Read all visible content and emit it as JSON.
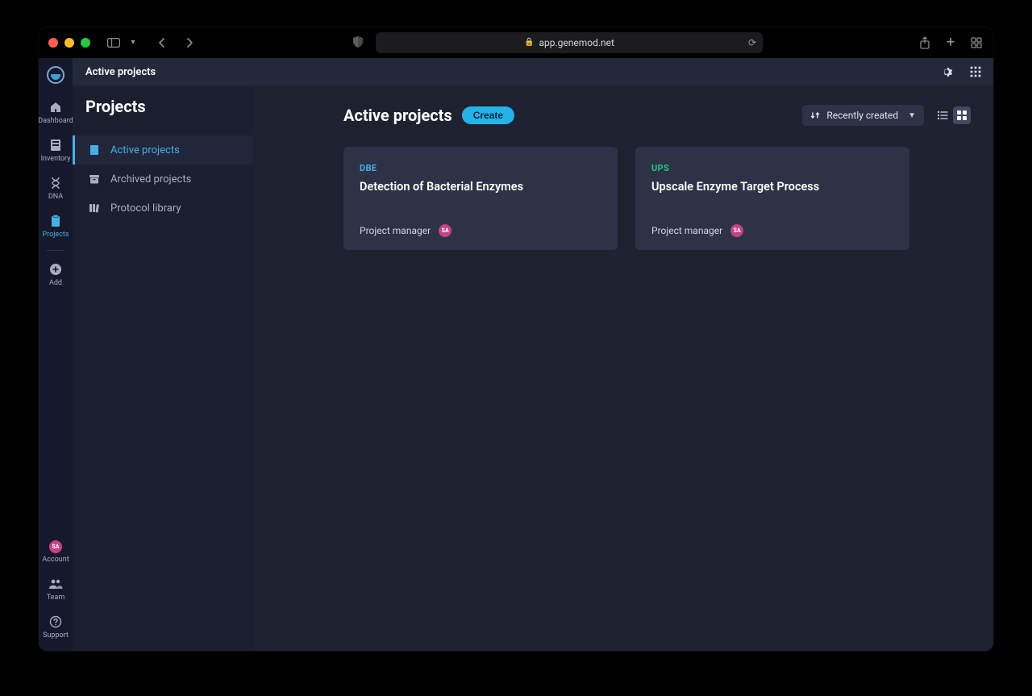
{
  "browser": {
    "url": "app.genemod.net"
  },
  "rail": {
    "items": [
      {
        "label": "Dashboard"
      },
      {
        "label": "Inventory"
      },
      {
        "label": "DNA"
      },
      {
        "label": "Projects"
      },
      {
        "label": "Add"
      }
    ],
    "account": {
      "label": "Account",
      "initials": "SA"
    },
    "team": {
      "label": "Team"
    },
    "support": {
      "label": "Support"
    }
  },
  "sidepanel": {
    "breadcrumb": "Active projects",
    "title": "Projects",
    "items": [
      {
        "label": "Active projects"
      },
      {
        "label": "Archived projects"
      },
      {
        "label": "Protocol library"
      }
    ]
  },
  "main": {
    "heading": "Active projects",
    "create_label": "Create",
    "sort_label": "Recently created",
    "projects": [
      {
        "code": "DBE",
        "code_color": "blue",
        "title": "Detection of Bacterial Enzymes",
        "pm_label": "Project manager",
        "pm_initials": "SA"
      },
      {
        "code": "UPS",
        "code_color": "green",
        "title": "Upscale Enzyme Target Process",
        "pm_label": "Project manager",
        "pm_initials": "SA"
      }
    ]
  }
}
